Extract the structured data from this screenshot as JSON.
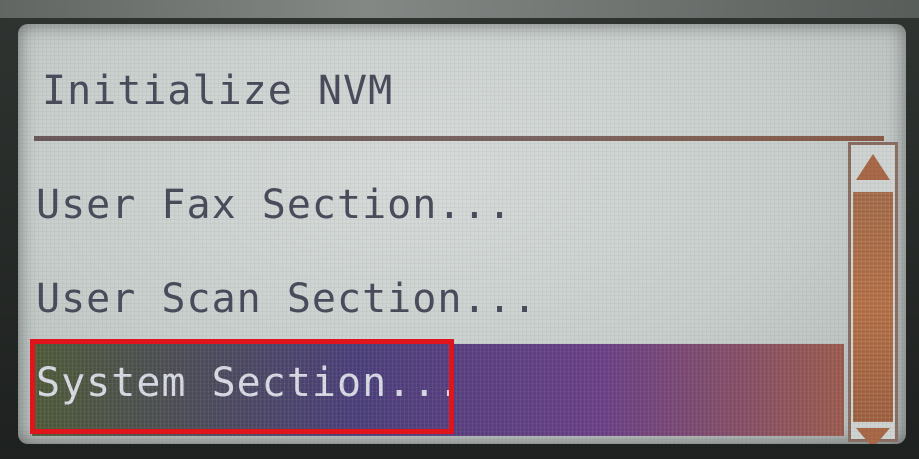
{
  "screen": {
    "title": "Initialize NVM",
    "menu_items": [
      {
        "label": "User Fax Section..."
      },
      {
        "label": "User Scan Section..."
      },
      {
        "label": "System Section...",
        "selected": true
      }
    ],
    "scrollbar": {
      "up_icon": "triangle-up-icon",
      "down_icon": "triangle-down-icon"
    },
    "highlight_color": "#e0141b"
  }
}
